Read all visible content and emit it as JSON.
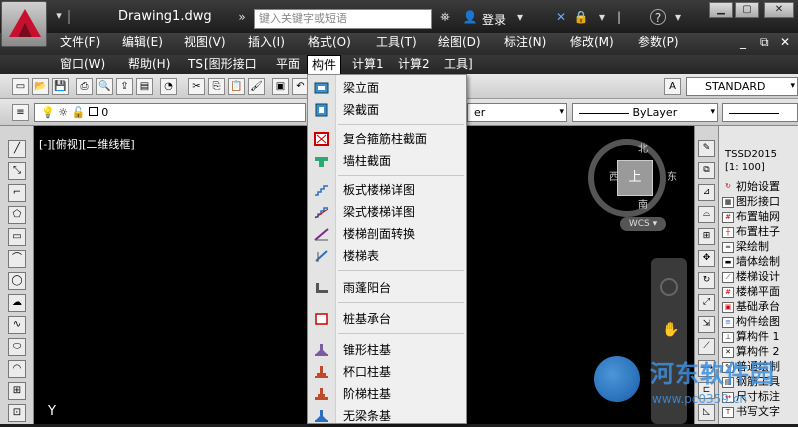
{
  "titlebar": {
    "doc_title": "Drawing1.dwg",
    "search_placeholder": "键入关键字或短语",
    "login": "登录"
  },
  "menu_row1": [
    "文件(F)",
    "编辑(E)",
    "视图(V)",
    "插入(I)",
    "格式(O)",
    "工具(T)",
    "绘图(D)",
    "标注(N)",
    "修改(M)",
    "参数(P)"
  ],
  "menu_row2": [
    "窗口(W)",
    "帮助(H)",
    "TS",
    "[图形接口",
    "平面",
    "构件",
    "计算1",
    "计算2",
    "工具]"
  ],
  "toolbar": {
    "text_style": "STANDARD",
    "layer_value": "0",
    "linetype": "ByLayer",
    "lineweight": "ByLayer",
    "layer_partial": "er"
  },
  "canvas": {
    "viewport_label": "[-][俯视][二维线框]",
    "viewcube_top": "上",
    "compass_n": "北",
    "compass_s": "南",
    "compass_e": "东",
    "compass_w": "西",
    "wcs": "WCS",
    "ucs_y": "Y"
  },
  "dropdown": {
    "items": [
      "梁立面",
      "梁截面",
      "复合箍筋柱截面",
      "墙柱截面",
      "板式楼梯详图",
      "梁式楼梯详图",
      "楼梯剖面转换",
      "楼梯表",
      "雨蓬阳台",
      "桩基承台",
      "锥形柱基",
      "杯口柱基",
      "阶梯柱基",
      "无梁条基"
    ]
  },
  "panel": {
    "title": "TSSD2015",
    "scale": "[1: 100]",
    "items": [
      "初始设置",
      "图形接口",
      "布置轴网",
      "布置柱子",
      "梁绘制",
      "墙体绘制",
      "楼梯设计",
      "楼梯平面",
      "基础承台",
      "构件绘图",
      "算构件 1",
      "算构件 2",
      "普通绘制",
      "钢筋工具",
      "尺寸标注",
      "书写文字"
    ]
  },
  "watermark": {
    "text": "河东软件园",
    "url": "www.pc0359.cn"
  },
  "colors": {
    "accent_red": "#c8102e",
    "panel_icon_red": "#cc0000",
    "canvas_bg": "#000000"
  }
}
